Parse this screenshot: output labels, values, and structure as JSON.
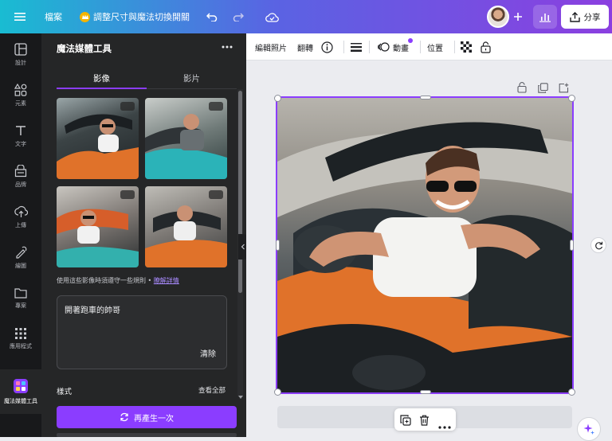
{
  "topbar": {
    "file_label": "檔案",
    "promo_label": "調整尺寸與魔法切換開關",
    "share_label": "分享"
  },
  "rail": {
    "items": [
      {
        "label": "設計",
        "icon": "layout-icon"
      },
      {
        "label": "元素",
        "icon": "shapes-icon"
      },
      {
        "label": "文字",
        "icon": "text-icon"
      },
      {
        "label": "品牌",
        "icon": "brand-icon"
      },
      {
        "label": "上傳",
        "icon": "upload-icon"
      },
      {
        "label": "繪圖",
        "icon": "draw-icon"
      },
      {
        "label": "專案",
        "icon": "folder-icon"
      },
      {
        "label": "應用程式",
        "icon": "apps-icon"
      },
      {
        "label": "魔法媒體工具",
        "icon": "magic-media-icon"
      }
    ]
  },
  "panel": {
    "title": "魔法媒體工具",
    "tabs": [
      {
        "label": "影像"
      },
      {
        "label": "影片"
      }
    ],
    "notice_text": "使用這些影像時須遵守一些規則 • ",
    "notice_link": "瞭解詳情",
    "prompt_value": "開著跑車的帥哥",
    "clear_label": "清除",
    "style_label": "樣式",
    "see_all_label": "查看全部",
    "regenerate_label": "再產生一次"
  },
  "toolbar": {
    "edit_photo_label": "編輯照片",
    "flip_label": "翻轉",
    "animate_label": "動畫",
    "position_label": "位置"
  },
  "colors": {
    "accent": "#8b3dff",
    "panel_bg": "#252627",
    "rail_bg": "#18191b",
    "canvas_bg": "#ebecf0"
  }
}
